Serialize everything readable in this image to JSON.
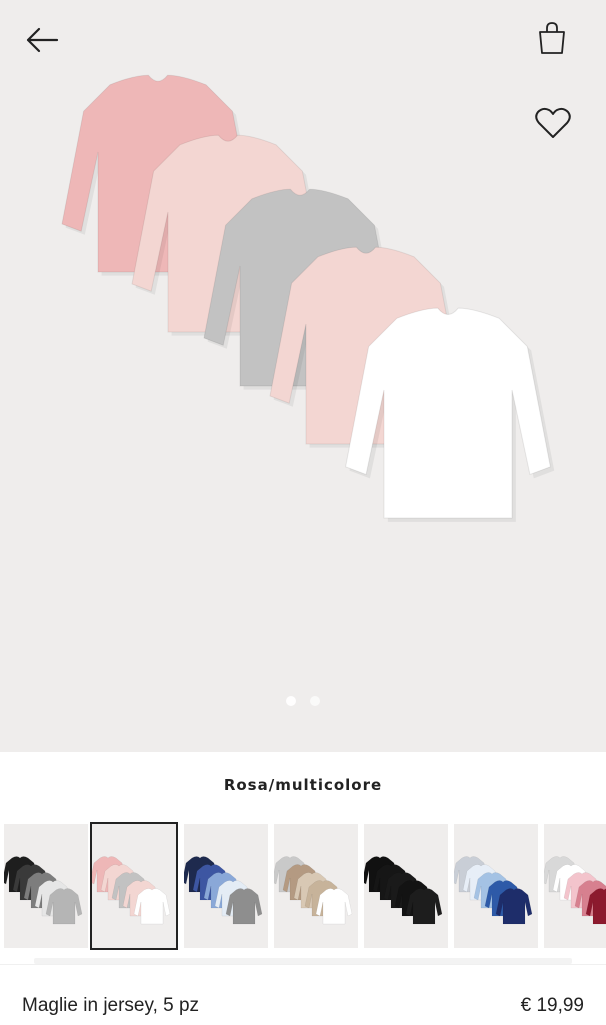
{
  "color_label": "Rosa/multicolore",
  "product": {
    "name": "Maglie in jersey, 5 pz",
    "price": "€ 19,99"
  },
  "carousel": {
    "total_images": 2,
    "active_index": 0
  },
  "header": {
    "back_icon": "arrow-left-icon",
    "bag_icon": "shopping-bag-icon",
    "favorite_icon": "heart-icon"
  },
  "colors": {
    "background": "#efedec",
    "pink": "#eeb7b7",
    "light_pink": "#f3d6d2",
    "grey": "#c2c2c2",
    "white": "#ffffff"
  },
  "swatches": [
    {
      "name": "black-grey",
      "colors": [
        "#1e1e1e",
        "#3a3a3a",
        "#7d7d7d",
        "#e6e6e6",
        "#b5b5b5"
      ],
      "selected": false
    },
    {
      "name": "pink-multicolor",
      "colors": [
        "#eeb7b7",
        "#f3d6d2",
        "#c2c2c2",
        "#f3d6d2",
        "#ffffff"
      ],
      "selected": true
    },
    {
      "name": "blue-multicolor",
      "colors": [
        "#1e2a4e",
        "#3d56a2",
        "#8aa8d8",
        "#e4ecf5",
        "#8e8e8e"
      ],
      "selected": false
    },
    {
      "name": "beige-multicolor",
      "colors": [
        "#c9c9c9",
        "#b49a82",
        "#d8c8b4",
        "#c7b39a",
        "#ffffff"
      ],
      "selected": false
    },
    {
      "name": "black",
      "colors": [
        "#111111",
        "#161616",
        "#1a1a1a",
        "#131313",
        "#1d1d1d"
      ],
      "selected": false
    },
    {
      "name": "light-blue-multicolor",
      "colors": [
        "#c9ced6",
        "#e7eef7",
        "#a4c2e4",
        "#2e5aa8",
        "#1e2d6a"
      ],
      "selected": false
    },
    {
      "name": "pink-burgundy",
      "colors": [
        "#d8d8d8",
        "#ffffff",
        "#f3c4cc",
        "#d7808f",
        "#8c1a2e"
      ],
      "selected": false
    }
  ]
}
